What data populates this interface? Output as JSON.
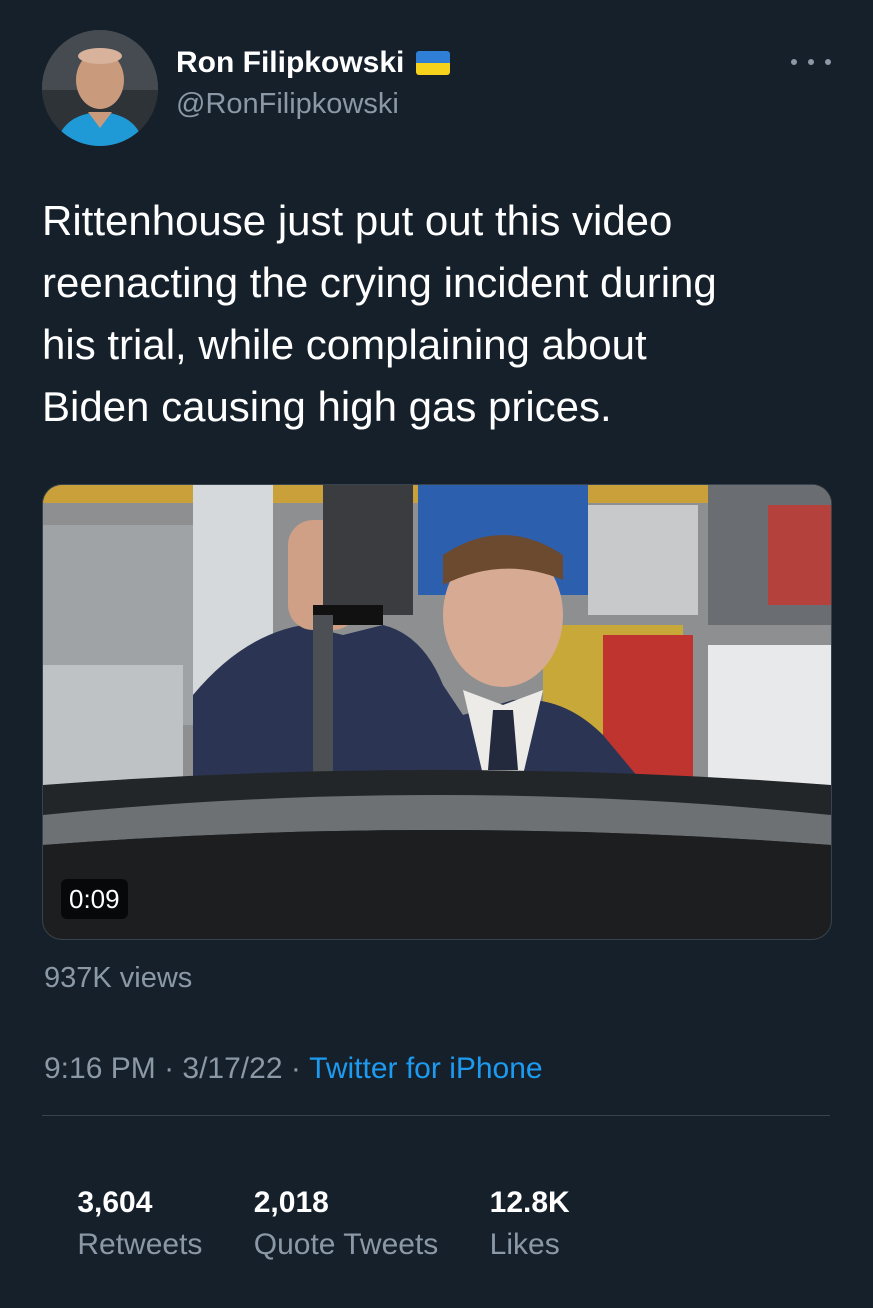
{
  "author": {
    "name": "Ron Filipkowski",
    "handle": "@RonFilipkowski",
    "flag_icon": "ukraine-flag-icon"
  },
  "tweet": {
    "text": "Rittenhouse just put out this video\nreenacting the crying incident during\nhis trial, while complaining about\nBiden causing high gas prices."
  },
  "media": {
    "duration": "0:09",
    "views": "937K views"
  },
  "meta": {
    "time": "9:16 PM",
    "separator": " · ",
    "date": "3/17/22",
    "source": "Twitter for iPhone"
  },
  "stats": {
    "retweets_count": "3,604",
    "retweets_label": "Retweets",
    "quotes_count": "2,018",
    "quotes_label": "Quote Tweets",
    "likes_count": "12.8K",
    "likes_label": "Likes"
  },
  "colors": {
    "background": "#15202b",
    "primary_text": "#ffffff",
    "secondary_text": "#8b98a5",
    "link": "#1d9bf0",
    "divider": "#38444d"
  }
}
